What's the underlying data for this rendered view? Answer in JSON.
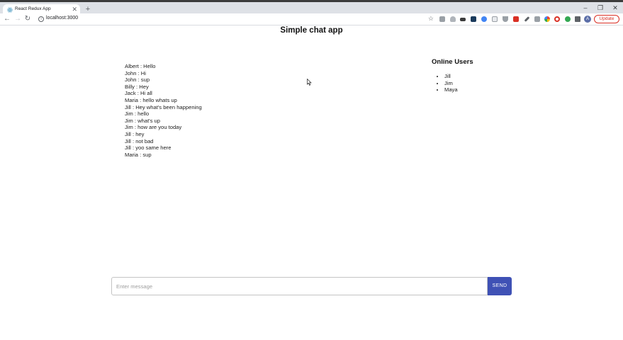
{
  "browser": {
    "tab_title": "React Redux App",
    "tab_close": "✕",
    "new_tab": "+",
    "url": "localhost:3000",
    "update_label": "Update",
    "profile_initial": "A",
    "window_controls": {
      "minimize": "–",
      "restore": "❐",
      "close": "✕"
    },
    "nav": {
      "back": "←",
      "forward": "→",
      "reload": "↻"
    }
  },
  "page": {
    "title": "Simple chat app"
  },
  "chat": {
    "messages": [
      "Albert : Hello",
      "John : Hi",
      "John : sup",
      "Billy : Hey",
      "Jack : Hi all",
      "Maria : hello whats up",
      "Jill : Hey what's been happening",
      "Jim : hello",
      "Jim : what's up",
      "Jim : how are you today",
      "Jill : hey",
      "Jill : not bad",
      "Jill : yoo same here",
      "Maria : sup"
    ]
  },
  "online": {
    "title": "Online Users",
    "users": [
      "Jill",
      "Jim",
      "Maya"
    ]
  },
  "composer": {
    "placeholder": "Enter message",
    "value": "",
    "send_label": "SEND"
  },
  "colors": {
    "accent": "#3f51b5",
    "update": "#d93025"
  }
}
